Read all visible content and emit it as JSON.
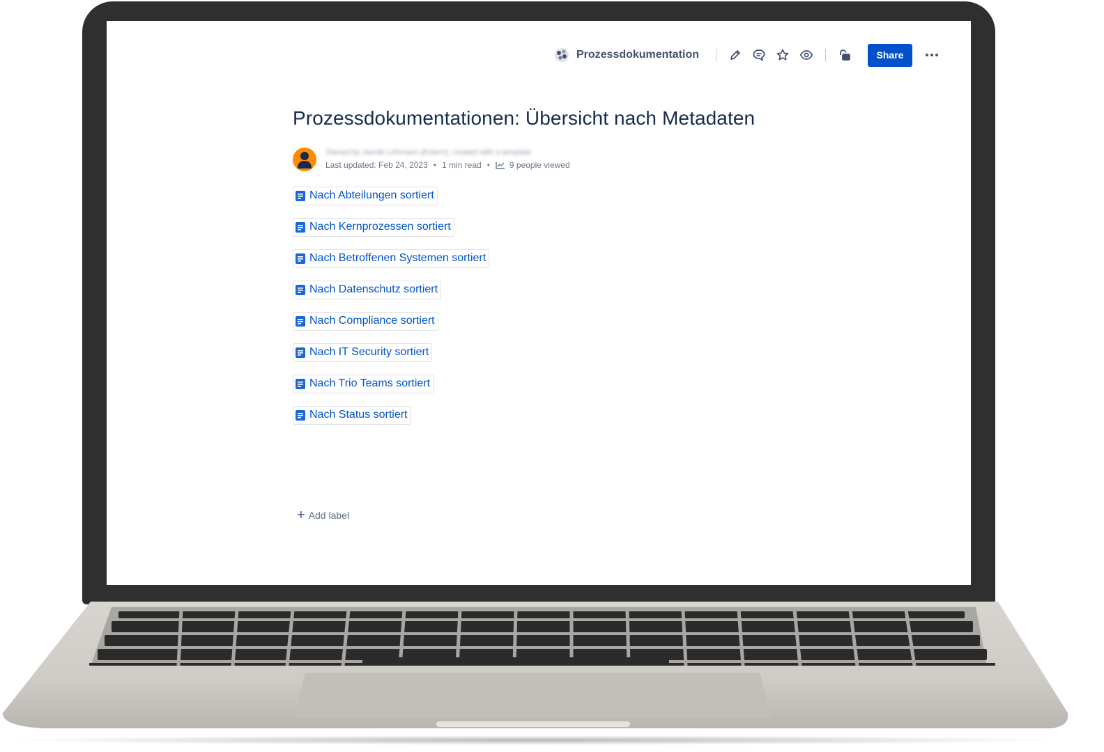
{
  "header": {
    "space_name": "Prozessdokumentation",
    "share_label": "Share",
    "icons": [
      "space-logo-icon",
      "edit-icon",
      "comment-icon",
      "star-icon",
      "watch-icon",
      "restrictions-icon",
      "more-icon"
    ]
  },
  "page": {
    "title": "Prozessdokumentationen: Übersicht nach Metadaten",
    "byline_blurred": "Owned by Jannik Lehmann (Extern), created with a template",
    "last_updated": "Last updated: Feb 24, 2023",
    "read_time": "1 min read",
    "views": "9 people viewed"
  },
  "links": [
    {
      "label": "Nach Abteilungen sortiert"
    },
    {
      "label": "Nach Kernprozessen sortiert"
    },
    {
      "label": "Nach Betroffenen Systemen sortiert"
    },
    {
      "label": "Nach Datenschutz sortiert"
    },
    {
      "label": "Nach Compliance sortiert"
    },
    {
      "label": "Nach IT Security sortiert"
    },
    {
      "label": "Nach Trio Teams sortiert"
    },
    {
      "label": "Nach Status sortiert"
    }
  ],
  "footer": {
    "add_label": "Add label"
  },
  "colors": {
    "accent": "#0052cc",
    "title": "#172b4d",
    "avatar": "#ff8b00",
    "bezel": "#2f2f30"
  }
}
